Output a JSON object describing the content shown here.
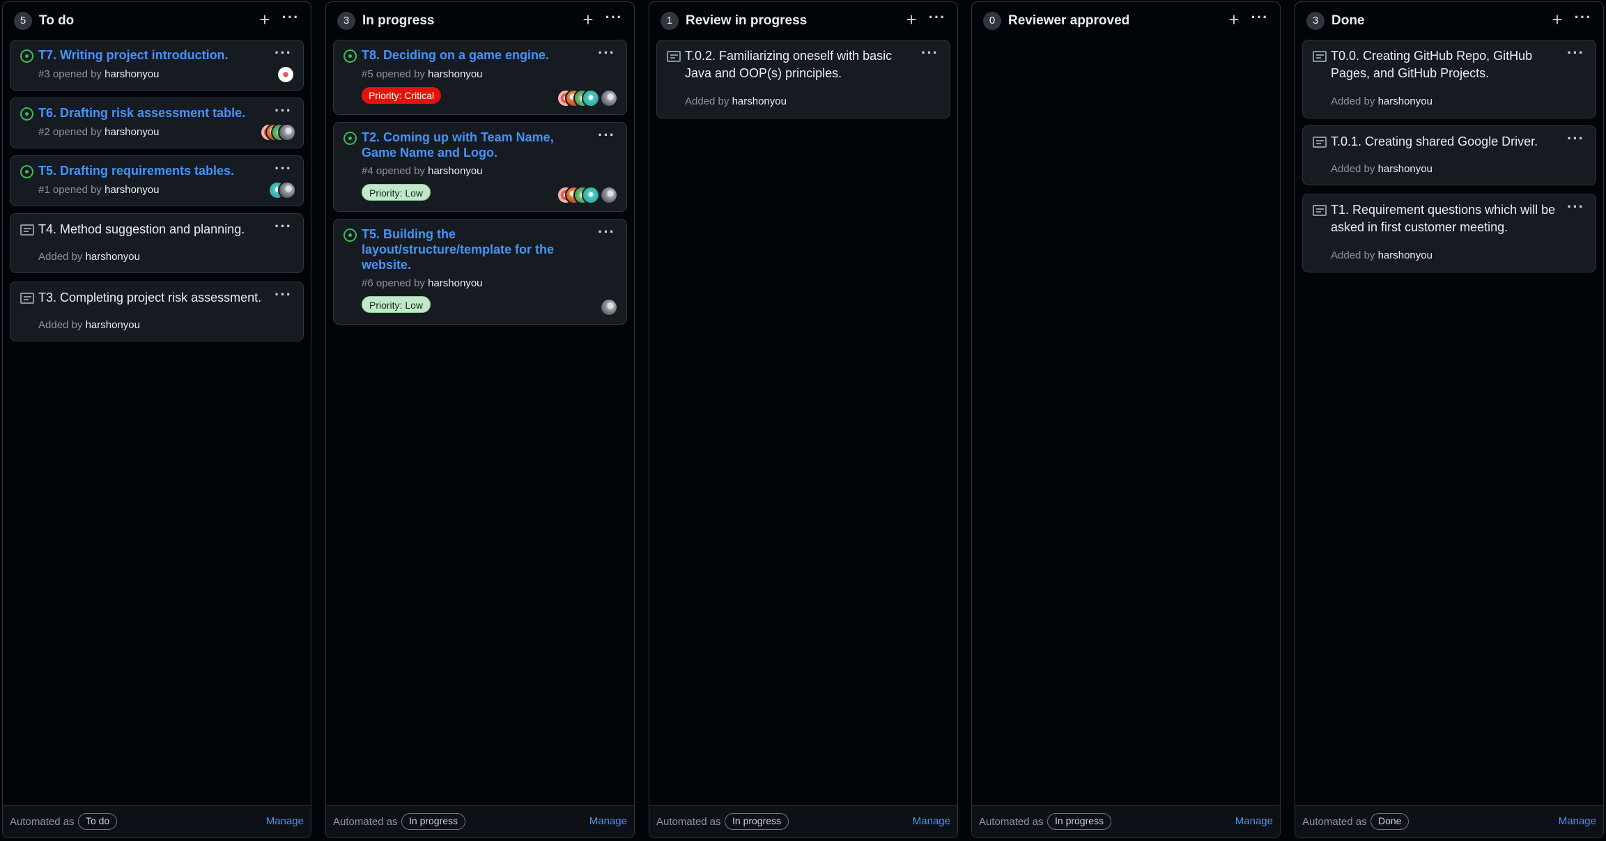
{
  "columns": [
    {
      "count": "5",
      "title": "To do",
      "automated_label": "Automated as",
      "automation": "To do",
      "manage": "Manage",
      "cards": [
        {
          "title": "T7. Writing project introduction.",
          "number": "#3",
          "opened_by": "opened by",
          "author": "harshonyou"
        },
        {
          "title": "T6. Drafting risk assessment table.",
          "number": "#2",
          "opened_by": "opened by",
          "author": "harshonyou"
        },
        {
          "title": "T5. Drafting requirements tables.",
          "number": "#1",
          "opened_by": "opened by",
          "author": "harshonyou"
        },
        {
          "title": "T4. Method suggestion and planning.",
          "added_by": "Added by",
          "author": "harshonyou"
        },
        {
          "title": "T3. Completing project risk assessment.",
          "added_by": "Added by",
          "author": "harshonyou"
        }
      ]
    },
    {
      "count": "3",
      "title": "In progress",
      "automated_label": "Automated as",
      "automation": "In progress",
      "manage": "Manage",
      "cards": [
        {
          "title": "T8. Deciding on a game engine.",
          "number": "#5",
          "opened_by": "opened by",
          "author": "harshonyou",
          "label": "Priority: Critical"
        },
        {
          "title": "T2. Coming up with Team Name, Game Name and Logo.",
          "number": "#4",
          "opened_by": "opened by",
          "author": "harshonyou",
          "label": "Priority: Low"
        },
        {
          "title": "T5. Building the layout/structure/template for the website.",
          "number": "#6",
          "opened_by": "opened by",
          "author": "harshonyou",
          "label": "Priority: Low"
        }
      ]
    },
    {
      "count": "1",
      "title": "Review in progress",
      "automated_label": "Automated as",
      "automation": "In progress",
      "manage": "Manage",
      "cards": [
        {
          "title": "T.0.2. Familiarizing oneself with basic Java and OOP(s) principles.",
          "added_by": "Added by",
          "author": "harshonyou"
        }
      ]
    },
    {
      "count": "0",
      "title": "Reviewer approved",
      "automated_label": "Automated as",
      "automation": "In progress",
      "manage": "Manage",
      "cards": []
    },
    {
      "count": "3",
      "title": "Done",
      "automated_label": "Automated as",
      "automation": "Done",
      "manage": "Manage",
      "cards": [
        {
          "title": "T0.0. Creating GitHub Repo, GitHub Pages, and GitHub Projects.",
          "added_by": "Added by",
          "author": "harshonyou"
        },
        {
          "title": "T.0.1. Creating shared Google Driver.",
          "added_by": "Added by",
          "author": "harshonyou"
        },
        {
          "title": "T1. Requirement questions which will be asked in first customer meeting.",
          "added_by": "Added by",
          "author": "harshonyou"
        }
      ]
    }
  ],
  "colors": {
    "background": "#010409",
    "card": "#161b22",
    "border": "#30363d",
    "link": "#4493f8",
    "issue_open": "#3fb950",
    "critical": "#e5120b",
    "low": "#c2e8c9"
  },
  "icons": {
    "add": "+",
    "more": "···"
  }
}
